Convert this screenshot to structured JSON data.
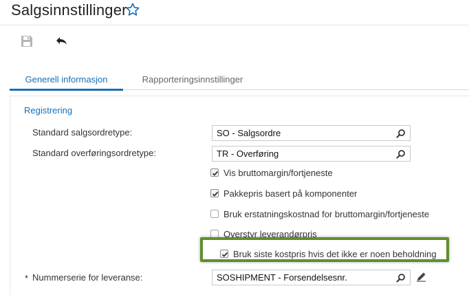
{
  "header": {
    "title": "Salgsinnstillinger",
    "favorite_icon": "star-outline-icon",
    "accent_color": "#1a6fb3"
  },
  "toolbar": {
    "save_icon": "save-icon",
    "undo_icon": "undo-icon"
  },
  "tabs": [
    {
      "label": "Generell informasjon",
      "active": true
    },
    {
      "label": "Rapporteringsinnstillinger",
      "active": false
    }
  ],
  "section": {
    "title": "Registrering"
  },
  "fields": {
    "sales_order_type": {
      "label": "Standard salgsordretype:",
      "value": "SO - Salgsordre",
      "icon": "search-icon"
    },
    "transfer_order_type": {
      "label": "Standard overføringsordretype:",
      "value": "TR - Overføring",
      "icon": "search-icon"
    },
    "shipment_numbering": {
      "label": "Nummerserie for leveranse:",
      "required_mark": "*",
      "value": "SOSHIPMENT - Forsendelsesnr.",
      "icon": "search-icon",
      "edit_icon": "pencil-icon"
    }
  },
  "checkboxes": [
    {
      "label": "Vis bruttomargin/fortjeneste",
      "checked": true
    },
    {
      "label": "Pakkepris basert på komponenter",
      "checked": true
    },
    {
      "label": "Bruk erstatningskostnad for bruttomargin/fortjeneste",
      "checked": false
    },
    {
      "label": "Overstyr leverandørpris",
      "checked": false
    },
    {
      "label": "Bruk siste kostpris hvis det ikke er noen beholdning",
      "checked": true
    }
  ],
  "highlight_color": "#5e8f2e"
}
